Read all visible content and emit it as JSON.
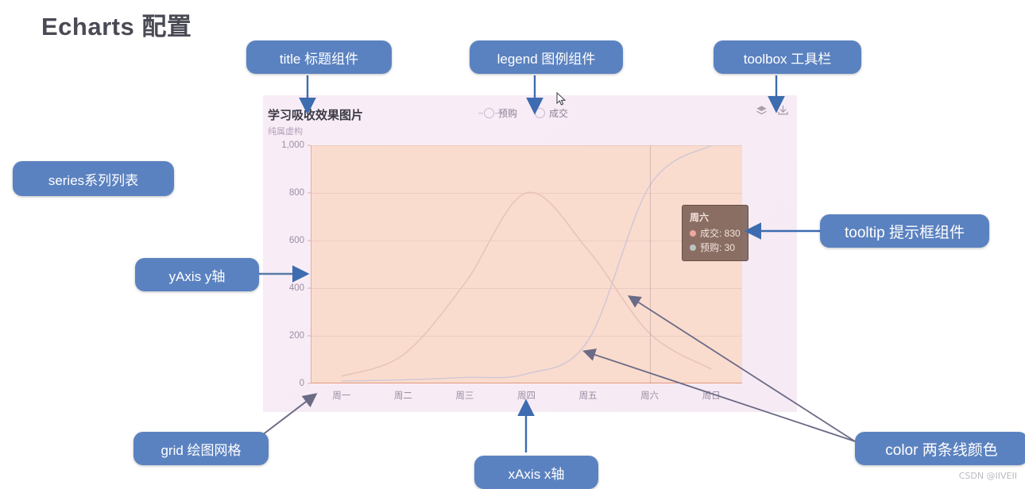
{
  "page": {
    "title": "Echarts 配置",
    "watermark": "CSDN @IIVEII"
  },
  "callouts": [
    {
      "id": "title",
      "label": "title 标题组件"
    },
    {
      "id": "legend",
      "label": "legend 图例组件"
    },
    {
      "id": "toolbox",
      "label": "toolbox 工具栏"
    },
    {
      "id": "series",
      "label": "series系列列表"
    },
    {
      "id": "yaxis",
      "label": "yAxis y轴"
    },
    {
      "id": "tooltip",
      "label": "tooltip 提示框组件"
    },
    {
      "id": "grid",
      "label": "grid 绘图网格"
    },
    {
      "id": "xaxis",
      "label": "xAxis x轴"
    },
    {
      "id": "color",
      "label": "color 两条线颜色"
    }
  ],
  "chart_data": {
    "type": "line",
    "title": "学习吸收效果图片",
    "subtitle": "纯属虚构",
    "xlabel": "",
    "ylabel": "",
    "ylim": [
      0,
      1000
    ],
    "yticks": [
      "0",
      "200",
      "400",
      "600",
      "800",
      "1,000"
    ],
    "grid": true,
    "legend_position": "top-center",
    "legend": [
      "预购",
      "成交"
    ],
    "categories": [
      "周一",
      "周二",
      "周三",
      "周四",
      "周五",
      "周六",
      "周日"
    ],
    "series": [
      {
        "name": "成交",
        "color": "#e8bdb0",
        "values": [
          30,
          120,
          420,
          800,
          560,
          210,
          60
        ]
      },
      {
        "name": "预购",
        "color": "#cfc2cf",
        "values": [
          10,
          15,
          25,
          40,
          180,
          830,
          1000
        ]
      }
    ],
    "axis_pointer_category": "周六",
    "toolbox_icons": [
      "stack-box-icon",
      "download-icon"
    ]
  },
  "tooltip": {
    "title": "周六",
    "rows": [
      {
        "marker_color": "#f0a79c",
        "text": "成交: 830"
      },
      {
        "marker_color": "#b9c4c0",
        "text": "预购: 30"
      }
    ]
  }
}
